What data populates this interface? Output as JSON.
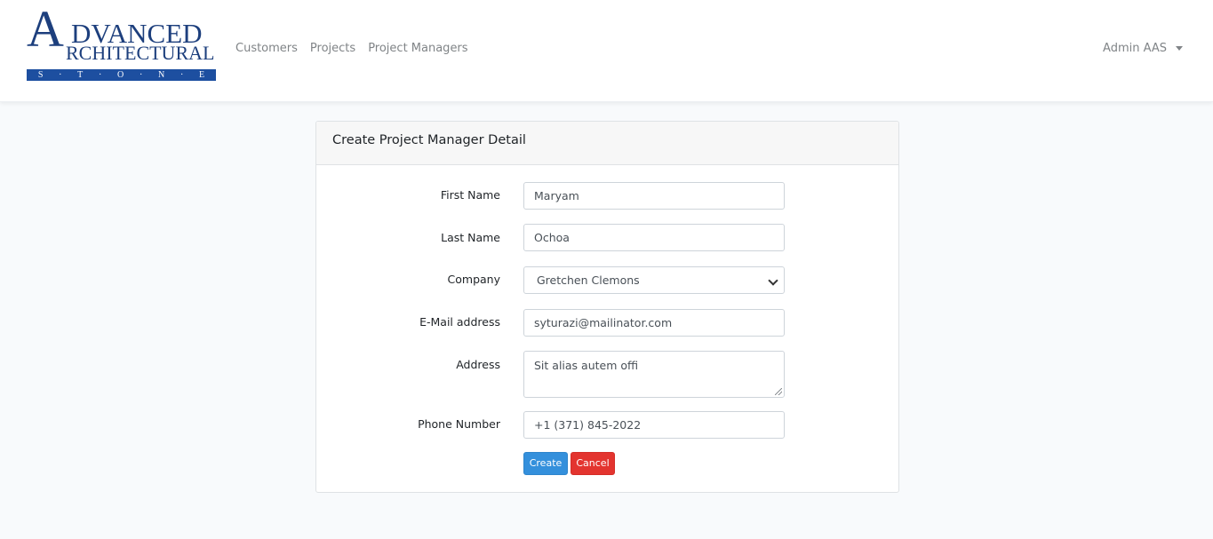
{
  "brand": {
    "big_letter_a": "A",
    "word_dvanced": "DVANCED",
    "word_rchitectural": "RCHITECTURAL",
    "stone_letters": [
      "S",
      "T",
      "O",
      "N",
      "E"
    ]
  },
  "nav": {
    "links": [
      "Customers",
      "Projects",
      "Project Managers"
    ],
    "user": "Admin AAS"
  },
  "form": {
    "title": "Create Project Manager Detail",
    "fields": {
      "first_name": {
        "label": "First Name",
        "value": "Maryam"
      },
      "last_name": {
        "label": "Last Name",
        "value": "Ochoa"
      },
      "company": {
        "label": "Company",
        "value": "Gretchen Clemons"
      },
      "email": {
        "label": "E-Mail address",
        "value": "syturazi@mailinator.com"
      },
      "address": {
        "label": "Address",
        "value": "Sit alias autem offi"
      },
      "phone": {
        "label": "Phone Number",
        "value": "+1 (371) 845-2022"
      }
    },
    "create_label": "Create",
    "cancel_label": "Cancel"
  },
  "colors": {
    "brand_blue": "#1d3f7d",
    "primary": "#3490dc",
    "danger": "#e3342f"
  }
}
